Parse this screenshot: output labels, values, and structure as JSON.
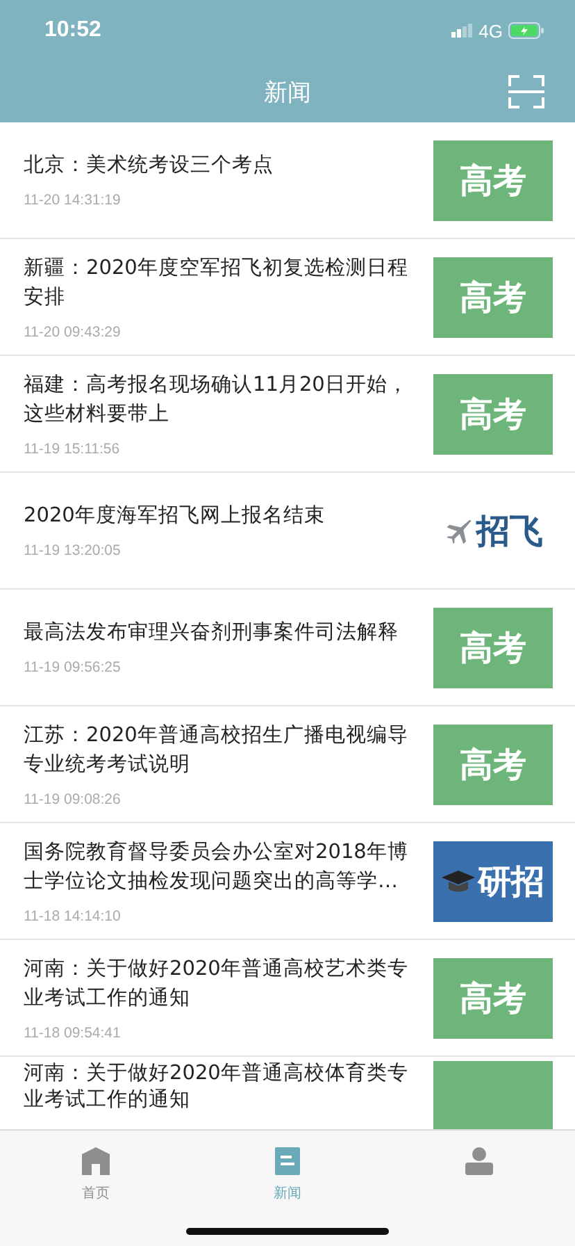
{
  "status_bar": {
    "time": "10:52",
    "network": "4G"
  },
  "header": {
    "title": "新闻"
  },
  "news": [
    {
      "title": "北京：美术统考设三个考点",
      "time": "11-20 14:31:19",
      "kind": "gaokao",
      "thumb_label": "高考"
    },
    {
      "title": "新疆：2020年度空军招飞初复选检测日程安排",
      "time": "11-20 09:43:29",
      "kind": "gaokao",
      "thumb_label": "高考"
    },
    {
      "title": "福建：高考报名现场确认11月20日开始，这些材料要带上",
      "time": "11-19 15:11:56",
      "kind": "gaokao",
      "thumb_label": "高考"
    },
    {
      "title": "2020年度海军招飞网上报名结束",
      "time": "11-19 13:20:05",
      "kind": "zhaofei",
      "thumb_label": "招飞"
    },
    {
      "title": "最高法发布审理兴奋剂刑事案件司法解释",
      "time": "11-19 09:56:25",
      "kind": "gaokao",
      "thumb_label": "高考"
    },
    {
      "title": "江苏：2020年普通高校招生广播电视编导专业统考考试说明",
      "time": "11-19 09:08:26",
      "kind": "gaokao",
      "thumb_label": "高考"
    },
    {
      "title": "国务院教育督导委员会办公室对2018年博士学位论文抽检发现问题突出的高等学…",
      "time": "11-18 14:14:10",
      "kind": "yanzhao",
      "thumb_label": "研招"
    },
    {
      "title": "河南：关于做好2020年普通高校艺术类专业考试工作的通知",
      "time": "11-18 09:54:41",
      "kind": "gaokao",
      "thumb_label": "高考"
    },
    {
      "title": "河南：关于做好2020年普通高校体育类专业考试工作的通知",
      "kind": "gaokao"
    }
  ],
  "tabs": [
    {
      "label": "首页",
      "kind": "home",
      "selected": false
    },
    {
      "label": "新闻",
      "kind": "news",
      "selected": true
    },
    {
      "kind": "person",
      "selected": false
    }
  ]
}
